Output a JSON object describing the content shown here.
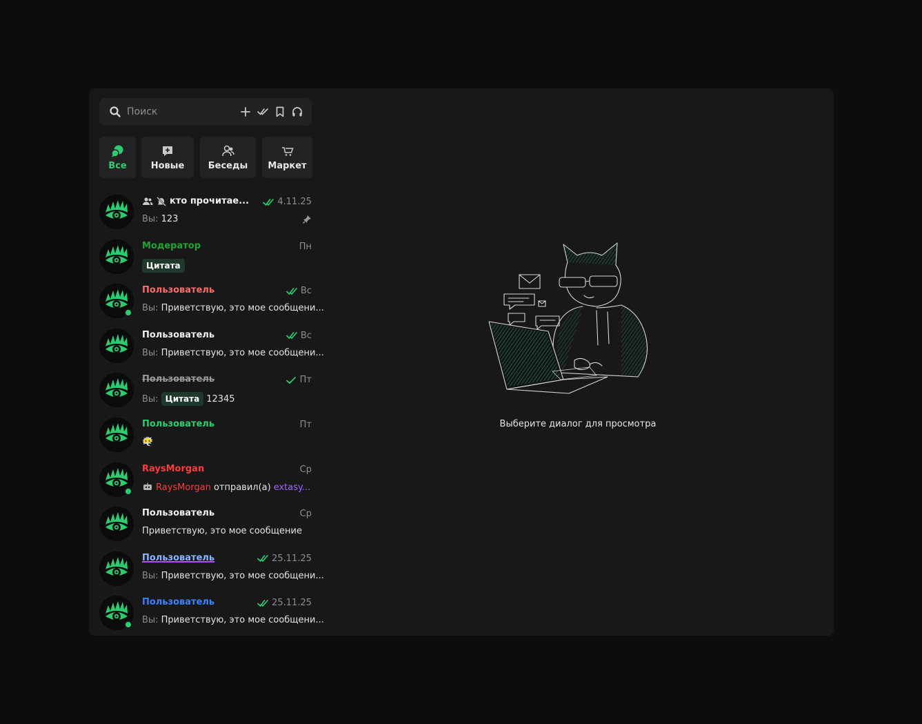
{
  "search": {
    "placeholder": "Поиск"
  },
  "toolbar_icons": [
    "plus-icon",
    "double-check-icon",
    "bookmark-icon",
    "headphones-icon"
  ],
  "tabs": [
    {
      "label": "Все",
      "icon": "chats-icon",
      "active": true
    },
    {
      "label": "Новые",
      "icon": "new-message-icon",
      "active": false
    },
    {
      "label": "Беседы",
      "icon": "group-icon",
      "active": false
    },
    {
      "label": "Маркет",
      "icon": "cart-icon",
      "active": false
    }
  ],
  "chats": [
    {
      "name": "кто прочитае...",
      "name_color": "#f0f0f0",
      "date": "4.11.25",
      "read": true,
      "you": "Вы:",
      "preview": "123",
      "group": true,
      "muted": true,
      "pinned": true
    },
    {
      "name": "Модератор",
      "name_color": "#1fa535",
      "date": "Пн",
      "preview_quote": "Цитата"
    },
    {
      "name": "Пользователь",
      "name_color": "#ff6b6b",
      "date": "Вс",
      "read": true,
      "online": true,
      "you": "Вы:",
      "preview": "Приветствую, это мое сообщени..."
    },
    {
      "name": "Пользователь",
      "name_color": "#f0f0f0",
      "date": "Вс",
      "read": true,
      "you": "Вы:",
      "preview": "Приветствую, это мое сообщени..."
    },
    {
      "name": "Пользователь",
      "name_color": "#9a9a9a",
      "strike": true,
      "date": "Пт",
      "read": true,
      "single": true,
      "you": "Вы:",
      "preview_quote": "Цитата",
      "preview": "12345"
    },
    {
      "name": "Пользователь",
      "name_color": "#2ecc71",
      "date": "Пт",
      "preview_emoji": "😶‍🌫️"
    },
    {
      "name": "RaysMorgan",
      "name_color": "#ff3b3b",
      "date": "Ср",
      "online": true,
      "bot": true,
      "preview_actor": "RaysMorgan",
      "preview": "отправил(а)",
      "preview_target": "extasy..."
    },
    {
      "name": "Пользователь",
      "name_color": "#f0f0f0",
      "date": "Ср",
      "preview": "Приветствую, это мое сообщение"
    },
    {
      "name": "Пользователь",
      "name_color": "#8ab4ff",
      "underline": true,
      "date": "25.11.25",
      "read": true,
      "you": "Вы:",
      "preview": "Приветствую, это мое сообщени..."
    },
    {
      "name": "Пользователь",
      "name_color": "#3b82ff",
      "date": "25.11.25",
      "read": true,
      "online": true,
      "you": "Вы:",
      "preview": "Приветствую, это мое сообщени..."
    }
  ],
  "empty_state": {
    "text": "Выберите диалог для просмотра"
  },
  "colors": {
    "accent": "#2ecc71",
    "panel": "#181819",
    "page": "#0d0d0e"
  }
}
